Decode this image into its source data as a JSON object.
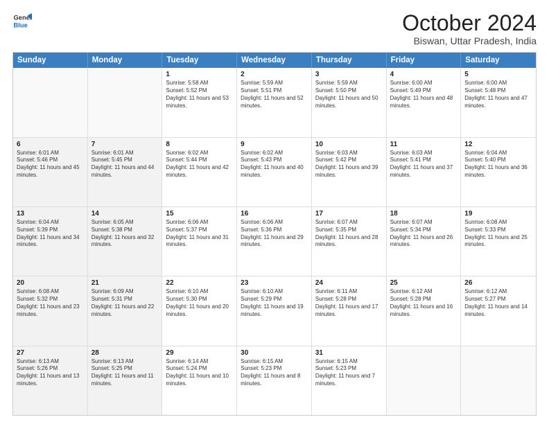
{
  "logo": {
    "line1": "General",
    "line2": "Blue"
  },
  "title": "October 2024",
  "location": "Biswan, Uttar Pradesh, India",
  "header_days": [
    "Sunday",
    "Monday",
    "Tuesday",
    "Wednesday",
    "Thursday",
    "Friday",
    "Saturday"
  ],
  "weeks": [
    [
      {
        "day": "",
        "sunrise": "",
        "sunset": "",
        "daylight": "",
        "shaded": true
      },
      {
        "day": "",
        "sunrise": "",
        "sunset": "",
        "daylight": "",
        "shaded": true
      },
      {
        "day": "1",
        "sunrise": "Sunrise: 5:58 AM",
        "sunset": "Sunset: 5:52 PM",
        "daylight": "Daylight: 11 hours and 53 minutes."
      },
      {
        "day": "2",
        "sunrise": "Sunrise: 5:59 AM",
        "sunset": "Sunset: 5:51 PM",
        "daylight": "Daylight: 11 hours and 52 minutes."
      },
      {
        "day": "3",
        "sunrise": "Sunrise: 5:59 AM",
        "sunset": "Sunset: 5:50 PM",
        "daylight": "Daylight: 11 hours and 50 minutes."
      },
      {
        "day": "4",
        "sunrise": "Sunrise: 6:00 AM",
        "sunset": "Sunset: 5:49 PM",
        "daylight": "Daylight: 11 hours and 48 minutes."
      },
      {
        "day": "5",
        "sunrise": "Sunrise: 6:00 AM",
        "sunset": "Sunset: 5:48 PM",
        "daylight": "Daylight: 11 hours and 47 minutes."
      }
    ],
    [
      {
        "day": "6",
        "sunrise": "Sunrise: 6:01 AM",
        "sunset": "Sunset: 5:46 PM",
        "daylight": "Daylight: 11 hours and 45 minutes.",
        "shaded": true
      },
      {
        "day": "7",
        "sunrise": "Sunrise: 6:01 AM",
        "sunset": "Sunset: 5:45 PM",
        "daylight": "Daylight: 11 hours and 44 minutes.",
        "shaded": true
      },
      {
        "day": "8",
        "sunrise": "Sunrise: 6:02 AM",
        "sunset": "Sunset: 5:44 PM",
        "daylight": "Daylight: 11 hours and 42 minutes."
      },
      {
        "day": "9",
        "sunrise": "Sunrise: 6:02 AM",
        "sunset": "Sunset: 5:43 PM",
        "daylight": "Daylight: 11 hours and 40 minutes."
      },
      {
        "day": "10",
        "sunrise": "Sunrise: 6:03 AM",
        "sunset": "Sunset: 5:42 PM",
        "daylight": "Daylight: 11 hours and 39 minutes."
      },
      {
        "day": "11",
        "sunrise": "Sunrise: 6:03 AM",
        "sunset": "Sunset: 5:41 PM",
        "daylight": "Daylight: 11 hours and 37 minutes."
      },
      {
        "day": "12",
        "sunrise": "Sunrise: 6:04 AM",
        "sunset": "Sunset: 5:40 PM",
        "daylight": "Daylight: 11 hours and 36 minutes."
      }
    ],
    [
      {
        "day": "13",
        "sunrise": "Sunrise: 6:04 AM",
        "sunset": "Sunset: 5:39 PM",
        "daylight": "Daylight: 11 hours and 34 minutes.",
        "shaded": true
      },
      {
        "day": "14",
        "sunrise": "Sunrise: 6:05 AM",
        "sunset": "Sunset: 5:38 PM",
        "daylight": "Daylight: 11 hours and 32 minutes.",
        "shaded": true
      },
      {
        "day": "15",
        "sunrise": "Sunrise: 6:06 AM",
        "sunset": "Sunset: 5:37 PM",
        "daylight": "Daylight: 11 hours and 31 minutes."
      },
      {
        "day": "16",
        "sunrise": "Sunrise: 6:06 AM",
        "sunset": "Sunset: 5:36 PM",
        "daylight": "Daylight: 11 hours and 29 minutes."
      },
      {
        "day": "17",
        "sunrise": "Sunrise: 6:07 AM",
        "sunset": "Sunset: 5:35 PM",
        "daylight": "Daylight: 11 hours and 28 minutes."
      },
      {
        "day": "18",
        "sunrise": "Sunrise: 6:07 AM",
        "sunset": "Sunset: 5:34 PM",
        "daylight": "Daylight: 11 hours and 26 minutes."
      },
      {
        "day": "19",
        "sunrise": "Sunrise: 6:08 AM",
        "sunset": "Sunset: 5:33 PM",
        "daylight": "Daylight: 11 hours and 25 minutes."
      }
    ],
    [
      {
        "day": "20",
        "sunrise": "Sunrise: 6:08 AM",
        "sunset": "Sunset: 5:32 PM",
        "daylight": "Daylight: 11 hours and 23 minutes.",
        "shaded": true
      },
      {
        "day": "21",
        "sunrise": "Sunrise: 6:09 AM",
        "sunset": "Sunset: 5:31 PM",
        "daylight": "Daylight: 11 hours and 22 minutes.",
        "shaded": true
      },
      {
        "day": "22",
        "sunrise": "Sunrise: 6:10 AM",
        "sunset": "Sunset: 5:30 PM",
        "daylight": "Daylight: 11 hours and 20 minutes."
      },
      {
        "day": "23",
        "sunrise": "Sunrise: 6:10 AM",
        "sunset": "Sunset: 5:29 PM",
        "daylight": "Daylight: 11 hours and 19 minutes."
      },
      {
        "day": "24",
        "sunrise": "Sunrise: 6:11 AM",
        "sunset": "Sunset: 5:28 PM",
        "daylight": "Daylight: 11 hours and 17 minutes."
      },
      {
        "day": "25",
        "sunrise": "Sunrise: 6:12 AM",
        "sunset": "Sunset: 5:28 PM",
        "daylight": "Daylight: 11 hours and 16 minutes."
      },
      {
        "day": "26",
        "sunrise": "Sunrise: 6:12 AM",
        "sunset": "Sunset: 5:27 PM",
        "daylight": "Daylight: 11 hours and 14 minutes."
      }
    ],
    [
      {
        "day": "27",
        "sunrise": "Sunrise: 6:13 AM",
        "sunset": "Sunset: 5:26 PM",
        "daylight": "Daylight: 11 hours and 13 minutes.",
        "shaded": true
      },
      {
        "day": "28",
        "sunrise": "Sunrise: 6:13 AM",
        "sunset": "Sunset: 5:25 PM",
        "daylight": "Daylight: 11 hours and 11 minutes.",
        "shaded": true
      },
      {
        "day": "29",
        "sunrise": "Sunrise: 6:14 AM",
        "sunset": "Sunset: 5:24 PM",
        "daylight": "Daylight: 11 hours and 10 minutes."
      },
      {
        "day": "30",
        "sunrise": "Sunrise: 6:15 AM",
        "sunset": "Sunset: 5:23 PM",
        "daylight": "Daylight: 11 hours and 8 minutes."
      },
      {
        "day": "31",
        "sunrise": "Sunrise: 6:15 AM",
        "sunset": "Sunset: 5:23 PM",
        "daylight": "Daylight: 11 hours and 7 minutes."
      },
      {
        "day": "",
        "sunrise": "",
        "sunset": "",
        "daylight": "",
        "shaded": false,
        "empty": true
      },
      {
        "day": "",
        "sunrise": "",
        "sunset": "",
        "daylight": "",
        "shaded": false,
        "empty": true
      }
    ]
  ]
}
